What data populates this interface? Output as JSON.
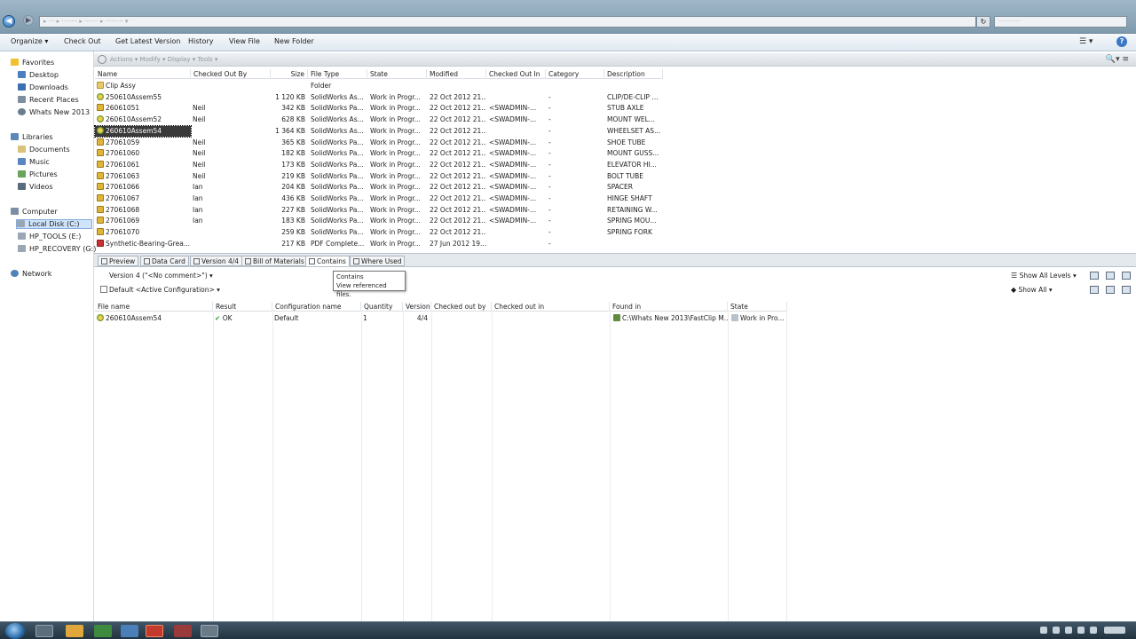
{
  "address": {
    "path": "▸ ··· ▸ ········ ▸ ······· ▸ ········· ▾",
    "search": "···········"
  },
  "toolbar": [
    {
      "label": "Organize ▾"
    },
    {
      "label": "Check Out"
    },
    {
      "label": "Get Latest Version"
    },
    {
      "label": "History"
    },
    {
      "label": "View File"
    },
    {
      "label": "New Folder"
    }
  ],
  "nav": {
    "favorites": "Favorites",
    "fav_items": [
      "Desktop",
      "Downloads",
      "Recent Places",
      "Whats New 2013"
    ],
    "libraries": "Libraries",
    "lib_items": [
      "Documents",
      "Music",
      "Pictures",
      "Videos"
    ],
    "computer": "Computer",
    "comp_items": [
      "Local Disk (C:)",
      "HP_TOOLS (E:)",
      "HP_RECOVERY (G:)"
    ],
    "network": "Network"
  },
  "breadcrumb": "Actions ▾  Modify ▾  Display ▾  Tools ▾",
  "file_columns": [
    "Name",
    "Checked Out By",
    "Size",
    "File Type",
    "State",
    "Modified",
    "Checked Out In",
    "Category",
    "Description"
  ],
  "files": [
    {
      "icon": "folder",
      "name": "Clip Assy",
      "by": "",
      "size": "",
      "type": "Folder",
      "state": "",
      "mod": "",
      "in": "",
      "cat": "",
      "desc": ""
    },
    {
      "icon": "asm",
      "name": "250610Assem55",
      "by": "",
      "size": "1 120 KB",
      "type": "SolidWorks As...",
      "state": "Work in Progr...",
      "mod": "22 Oct 2012 21...",
      "in": "",
      "cat": "-",
      "desc": "CLIP/DE-CLIP ..."
    },
    {
      "icon": "part",
      "name": "26061051",
      "by": "Neil",
      "size": "342 KB",
      "type": "SolidWorks Pa...",
      "state": "Work in Progr...",
      "mod": "22 Oct 2012 21...",
      "in": "<SWADMIN-...",
      "cat": "-",
      "desc": "STUB AXLE"
    },
    {
      "icon": "asm",
      "name": "260610Assem52",
      "by": "Neil",
      "size": "628 KB",
      "type": "SolidWorks As...",
      "state": "Work in Progr...",
      "mod": "22 Oct 2012 21...",
      "in": "<SWADMIN-...",
      "cat": "-",
      "desc": "MOUNT WEL..."
    },
    {
      "icon": "asm",
      "name": "260610Assem54",
      "by": "",
      "size": "1 364 KB",
      "type": "SolidWorks As...",
      "state": "Work in Progr...",
      "mod": "22 Oct 2012 21...",
      "in": "",
      "cat": "-",
      "desc": "WHEELSET AS...",
      "sel": true
    },
    {
      "icon": "part",
      "name": "27061059",
      "by": "Neil",
      "size": "365 KB",
      "type": "SolidWorks Pa...",
      "state": "Work in Progr...",
      "mod": "22 Oct 2012 21...",
      "in": "<SWADMIN-...",
      "cat": "-",
      "desc": "SHOE TUBE"
    },
    {
      "icon": "part",
      "name": "27061060",
      "by": "Neil",
      "size": "182 KB",
      "type": "SolidWorks Pa...",
      "state": "Work in Progr...",
      "mod": "22 Oct 2012 21...",
      "in": "<SWADMIN-...",
      "cat": "-",
      "desc": "MOUNT GUSS..."
    },
    {
      "icon": "part",
      "name": "27061061",
      "by": "Neil",
      "size": "173 KB",
      "type": "SolidWorks Pa...",
      "state": "Work in Progr...",
      "mod": "22 Oct 2012 21...",
      "in": "<SWADMIN-...",
      "cat": "-",
      "desc": "ELEVATOR HI..."
    },
    {
      "icon": "part",
      "name": "27061063",
      "by": "Neil",
      "size": "219 KB",
      "type": "SolidWorks Pa...",
      "state": "Work in Progr...",
      "mod": "22 Oct 2012 21...",
      "in": "<SWADMIN-...",
      "cat": "-",
      "desc": "BOLT TUBE"
    },
    {
      "icon": "part",
      "name": "27061066",
      "by": "Ian",
      "size": "204 KB",
      "type": "SolidWorks Pa...",
      "state": "Work in Progr...",
      "mod": "22 Oct 2012 21...",
      "in": "<SWADMIN-...",
      "cat": "-",
      "desc": "SPACER"
    },
    {
      "icon": "part",
      "name": "27061067",
      "by": "Ian",
      "size": "436 KB",
      "type": "SolidWorks Pa...",
      "state": "Work in Progr...",
      "mod": "22 Oct 2012 21...",
      "in": "<SWADMIN-...",
      "cat": "-",
      "desc": "HINGE SHAFT"
    },
    {
      "icon": "part",
      "name": "27061068",
      "by": "Ian",
      "size": "227 KB",
      "type": "SolidWorks Pa...",
      "state": "Work in Progr...",
      "mod": "22 Oct 2012 21...",
      "in": "<SWADMIN-...",
      "cat": "-",
      "desc": "RETAINING W..."
    },
    {
      "icon": "part",
      "name": "27061069",
      "by": "Ian",
      "size": "183 KB",
      "type": "SolidWorks Pa...",
      "state": "Work in Progr...",
      "mod": "22 Oct 2012 21...",
      "in": "<SWADMIN-...",
      "cat": "-",
      "desc": "SPRING MOU..."
    },
    {
      "icon": "part",
      "name": "27061070",
      "by": "",
      "size": "259 KB",
      "type": "SolidWorks Pa...",
      "state": "Work in Progr...",
      "mod": "22 Oct 2012 21...",
      "in": "",
      "cat": "-",
      "desc": "SPRING FORK"
    },
    {
      "icon": "pdf",
      "name": "Synthetic-Bearing-Grea...",
      "by": "",
      "size": "217 KB",
      "type": "PDF Complete...",
      "state": "Work in Progr...",
      "mod": "27 Jun 2012 19...",
      "in": "",
      "cat": "-",
      "desc": ""
    }
  ],
  "tabs": [
    "Preview",
    "Data Card",
    "Version 4/4",
    "Bill of Materials",
    "Contains",
    "Where Used"
  ],
  "tooltip": {
    "title": "Contains",
    "text": "View referenced files."
  },
  "version_select": "Version 4 (\"<No comment>\") ▾",
  "config_select": "Default <Active Configuration> ▾",
  "right_tools": {
    "show_all_levels": "Show All Levels ▾",
    "show_all": "Show All ▾"
  },
  "ref_columns": [
    "File name",
    "Result",
    "Configuration name",
    "Quantity",
    "Version",
    "Checked out by",
    "Checked out in",
    "Found in",
    "State"
  ],
  "refs": [
    {
      "name": "260610Assem54",
      "result": "OK",
      "config": "Default",
      "qty": "1",
      "version": "4/4",
      "by": "",
      "in": "",
      "found": "C:\\Whats New 2013\\FastClip M...",
      "state": "Work in Pro..."
    }
  ],
  "colors": {
    "accent": "#3b78c5",
    "selection": "#cfe3fb",
    "ok_green": "#2f9a2f"
  }
}
